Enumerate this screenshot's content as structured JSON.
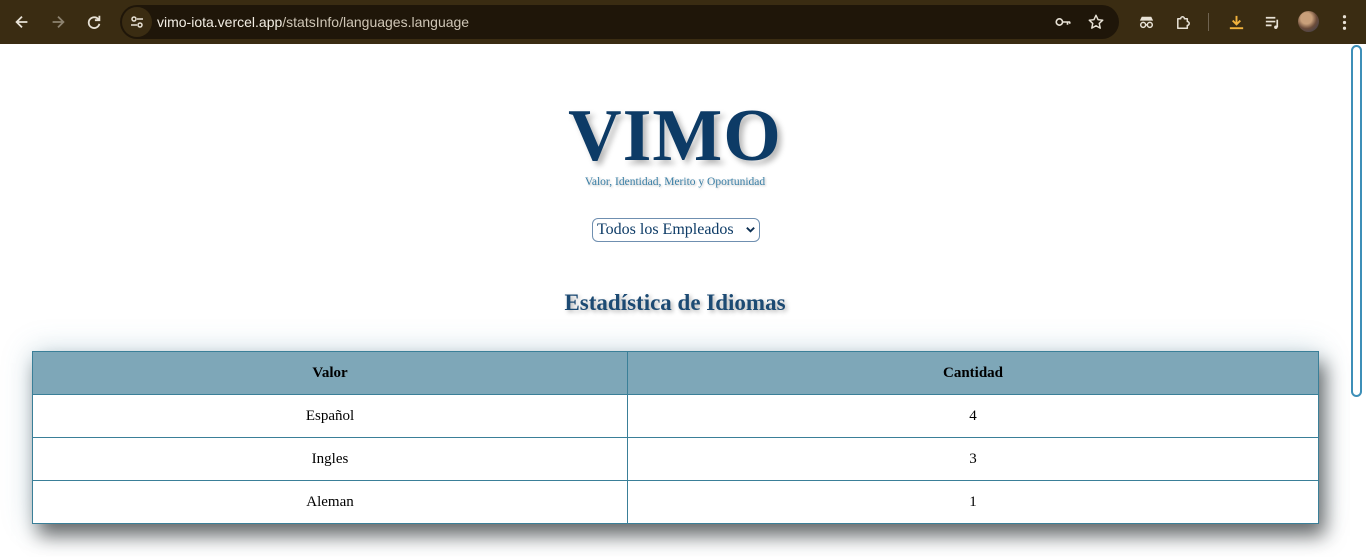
{
  "browser": {
    "url_host": "vimo-iota.vercel.app",
    "url_path": "/statsInfo/languages.language"
  },
  "page": {
    "logo_title": "VIMO",
    "logo_subtitle": "Valor, Identidad, Merito y Oportunidad",
    "employee_filter": {
      "selected": "Todos los Empleados"
    },
    "section_title": "Estadística de Idiomas",
    "table": {
      "headers": [
        "Valor",
        "Cantidad"
      ],
      "rows": [
        {
          "valor": "Español",
          "cantidad": "4"
        },
        {
          "valor": "Ingles",
          "cantidad": "3"
        },
        {
          "valor": "Aleman",
          "cantidad": "1"
        }
      ]
    }
  },
  "colors": {
    "brand_navy": "#0d3b66",
    "table_header": "#7ea7b8",
    "chrome_bar": "#3a2c12"
  },
  "icons": {
    "back": "arrow-left-icon",
    "forward": "arrow-right-icon",
    "reload": "reload-icon",
    "site_info": "tune-icon",
    "password": "key-icon",
    "bookmark": "star-icon",
    "incognito_ext": "spy-icon",
    "extensions": "puzzle-icon",
    "download": "download-icon",
    "media": "playlist-icon",
    "menu": "kebab-menu-icon"
  }
}
